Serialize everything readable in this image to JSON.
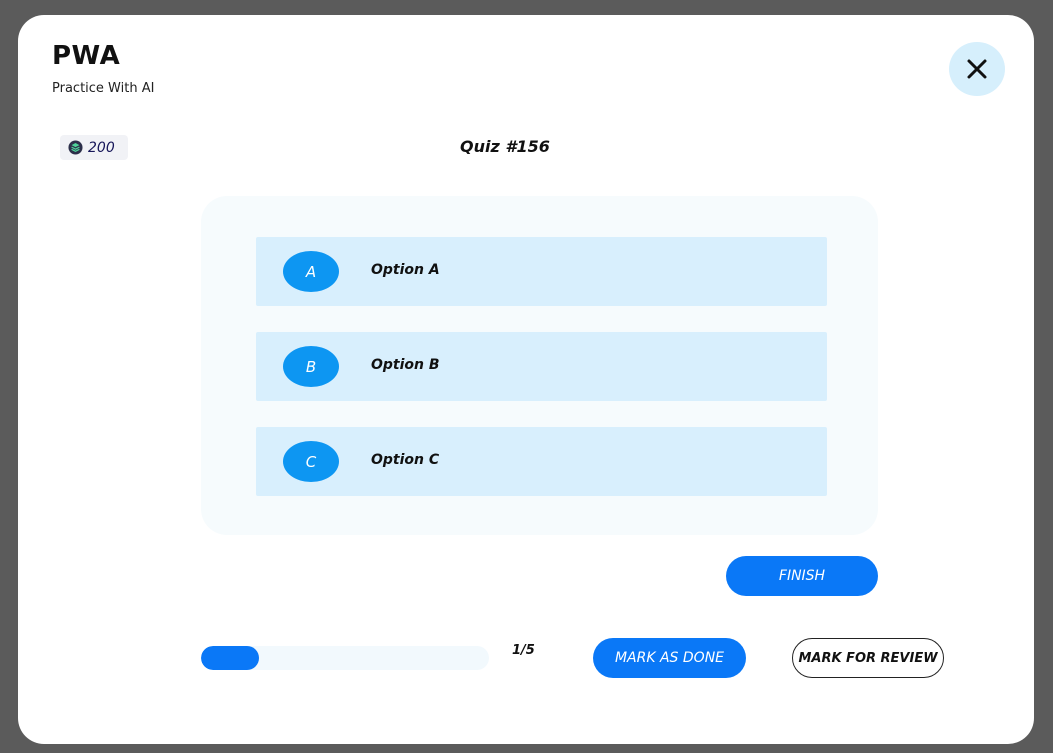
{
  "header": {
    "title": "PWA",
    "subtitle": "Practice With AI",
    "close_icon": "close-icon"
  },
  "coins": {
    "icon": "layers-coin-icon",
    "amount": "200"
  },
  "quiz": {
    "title": "Quiz #156"
  },
  "options": [
    {
      "letter": "A",
      "label": "Option A"
    },
    {
      "letter": "B",
      "label": "Option B"
    },
    {
      "letter": "C",
      "label": "Option C"
    }
  ],
  "actions": {
    "finish_label": "FINISH",
    "mark_done_label": "MARK AS DONE",
    "mark_review_label": "MARK FOR REVIEW"
  },
  "progress": {
    "current": 1,
    "total": 5,
    "fraction": 0.2,
    "label": "1/5"
  },
  "colors": {
    "primary": "#0a78f7",
    "option_background": "#d8effd",
    "option_letter": "#0d96f2",
    "close_background": "#d6effc"
  }
}
